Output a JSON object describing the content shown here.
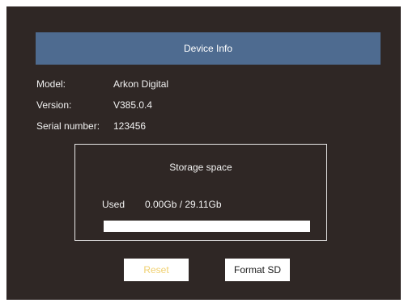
{
  "header": {
    "title": "Device Info"
  },
  "info": {
    "model_label": "Model:",
    "model_value": "Arkon Digital",
    "version_label": "Version:",
    "version_value": "V385.0.4",
    "serial_label": "Serial number:",
    "serial_value": "123456"
  },
  "storage": {
    "title": "Storage space",
    "used_label": "Used",
    "used_value": "0.00Gb / 29.11Gb",
    "used_fraction": 0.0
  },
  "buttons": {
    "reset_label": "Reset",
    "format_label": "Format SD"
  },
  "colors": {
    "background": "#2f2725",
    "header": "#4e6b90",
    "reset_text": "#f0d070"
  }
}
